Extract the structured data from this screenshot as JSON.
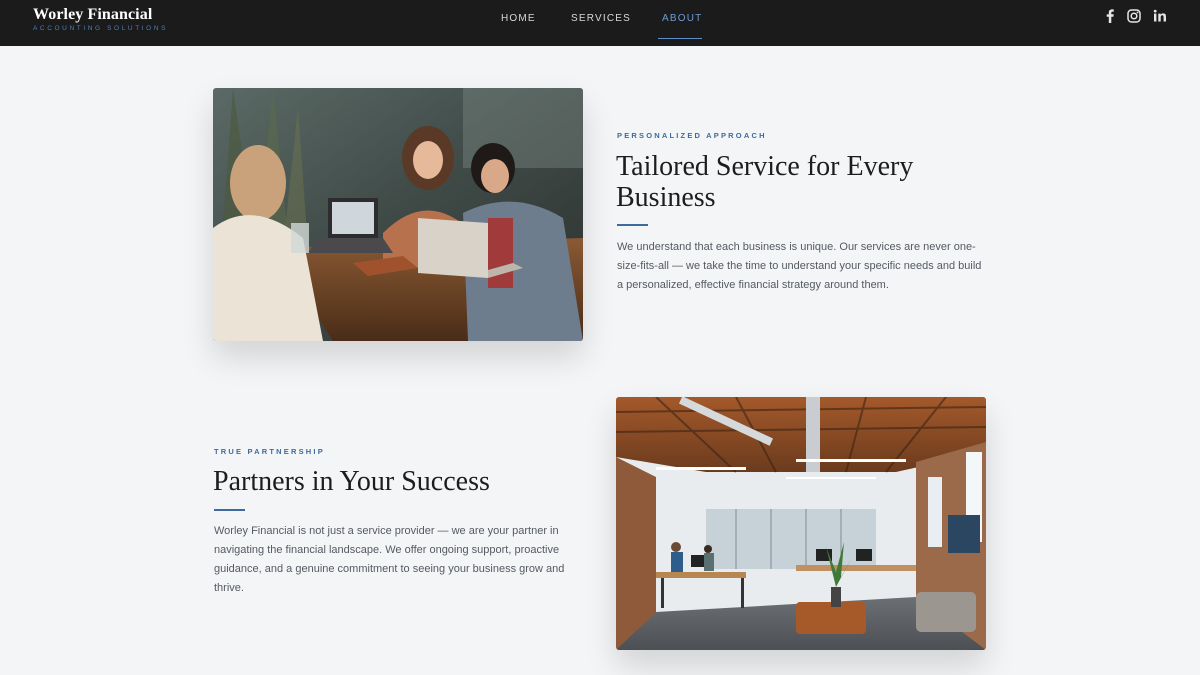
{
  "brand": {
    "name": "Worley Financial",
    "tagline": "ACCOUNTING SOLUTIONS"
  },
  "nav": {
    "items": [
      {
        "label": "HOME",
        "active": false
      },
      {
        "label": "SERVICES",
        "active": false
      },
      {
        "label": "ABOUT",
        "active": true
      }
    ]
  },
  "social": [
    {
      "icon": "facebook-icon"
    },
    {
      "icon": "instagram-icon"
    },
    {
      "icon": "linkedin-icon"
    }
  ],
  "colors": {
    "header_bg": "#1b1b1b",
    "accent": "#3f6a9c",
    "nav_active": "#6f9cd2",
    "page_bg": "#f4f5f7"
  },
  "sections": [
    {
      "eyebrow": "PERSONALIZED APPROACH",
      "heading_line1": "Tailored Service for Every",
      "heading_line2": "Business",
      "body_line1": "We understand that each business is unique. Our services are never one-",
      "body_line2": "size-fits-all — we take the time to understand your specific needs and build",
      "body_line3": "a personalized, effective financial strategy around them."
    },
    {
      "eyebrow": "TRUE PARTNERSHIP",
      "heading_line1": "Partners in Your Success",
      "body_line1": "Worley Financial is not just a service provider — we are your partner in",
      "body_line2": "navigating the financial landscape. We offer ongoing support, proactive",
      "body_line3": "guidance, and a genuine commitment to seeing your business grow and",
      "body_line4": "thrive."
    }
  ]
}
